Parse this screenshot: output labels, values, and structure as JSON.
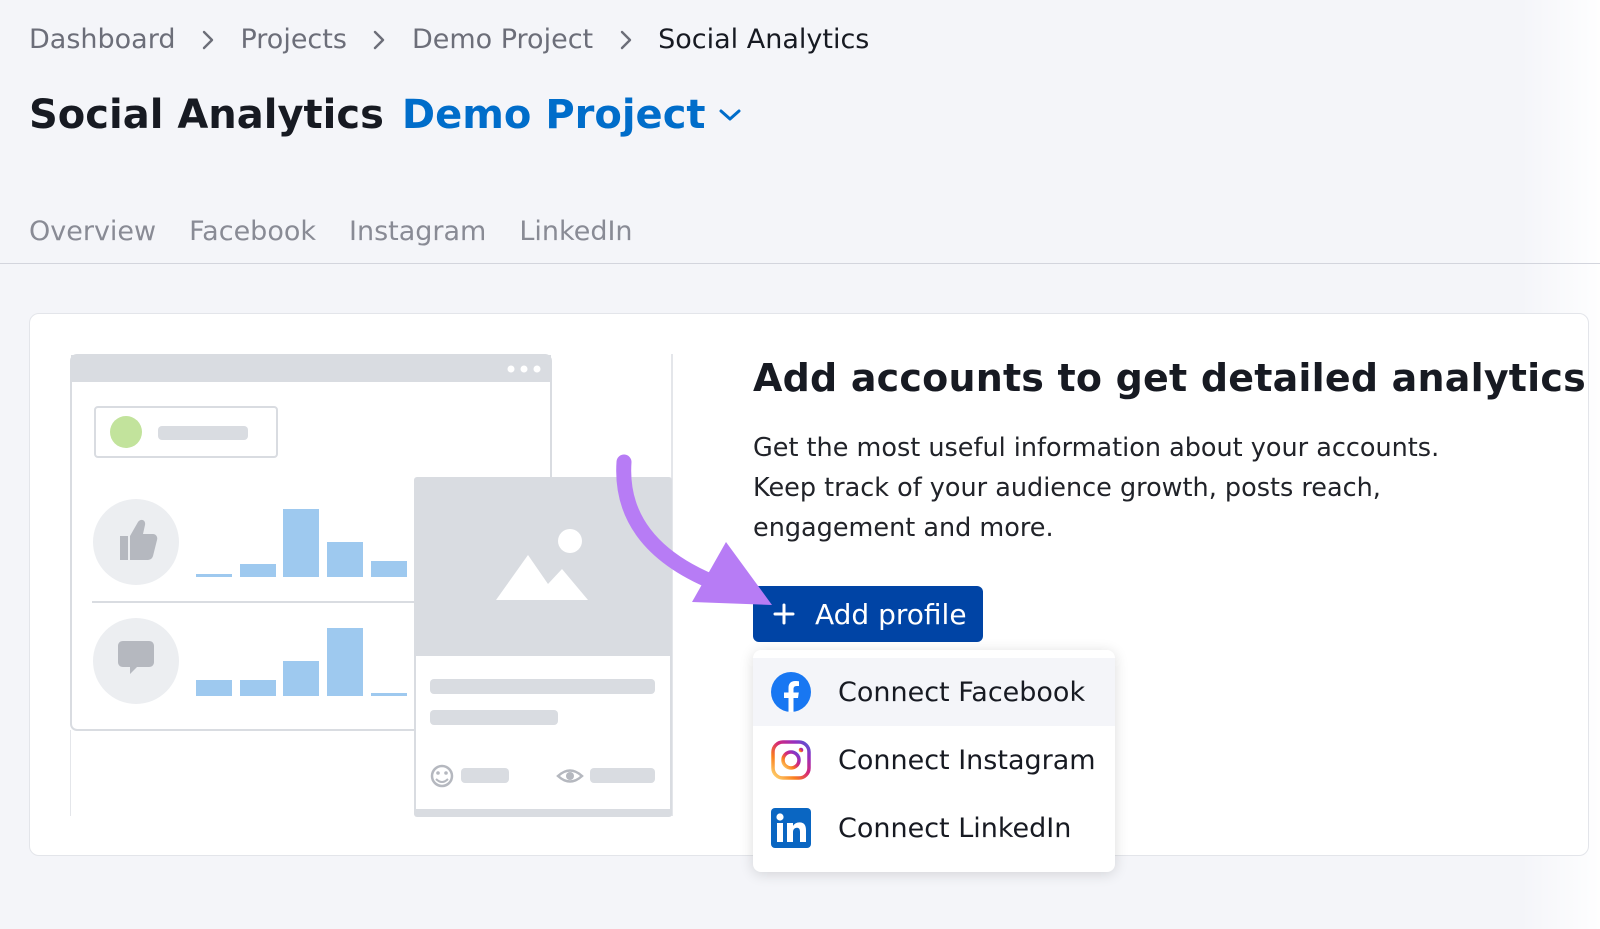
{
  "breadcrumb": {
    "items": [
      "Dashboard",
      "Projects",
      "Demo Project",
      "Social Analytics"
    ]
  },
  "header": {
    "title": "Social Analytics",
    "project": "Demo Project"
  },
  "tabs": [
    "Overview",
    "Facebook",
    "Instagram",
    "LinkedIn"
  ],
  "main": {
    "heading": "Add accounts to get detailed analytics",
    "description_lines": [
      "Get the most useful information about your accounts.",
      "Keep track of your audience growth, posts reach,",
      "engagement and more."
    ],
    "add_button": "Add profile"
  },
  "dropdown": {
    "items": [
      {
        "label": "Connect Facebook",
        "icon": "facebook-icon"
      },
      {
        "label": "Connect Instagram",
        "icon": "instagram-icon"
      },
      {
        "label": "Connect LinkedIn",
        "icon": "linkedin-icon"
      }
    ]
  },
  "colors": {
    "accent": "#006dca",
    "button": "#0044a5",
    "arrow": "#b77cf5",
    "illustration_bars": "#9ec9ef"
  }
}
